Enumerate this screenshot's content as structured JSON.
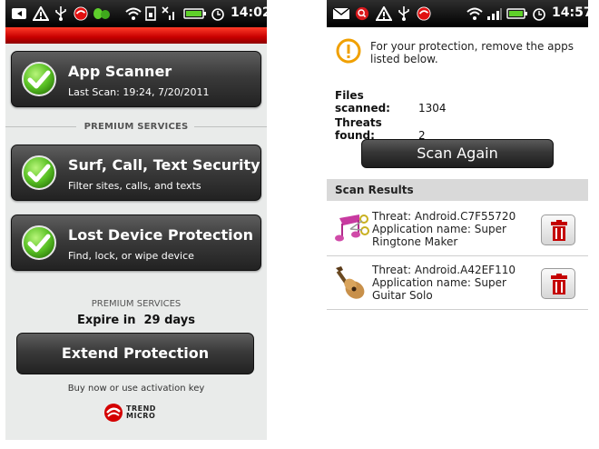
{
  "left": {
    "status": {
      "time": "14:02"
    },
    "features": [
      {
        "title": "App Scanner",
        "subtitle": "Last Scan: 19:24, 7/20/2011"
      },
      {
        "title": "Surf, Call, Text Security",
        "subtitle": "Filter sites, calls, and texts"
      },
      {
        "title": "Lost Device Protection",
        "subtitle": "Find, lock, or wipe device"
      }
    ],
    "premium_label": "PREMIUM SERVICES",
    "premium_label2": "PREMIUM SERVICES",
    "expire_text": "Expire in  29 days",
    "extend_button": "Extend Protection",
    "buy_now": "Buy now or use activation key",
    "logo_text": "TREND\nMICRO"
  },
  "right": {
    "status": {
      "time": "14:57"
    },
    "warning": "For your protection, remove the apps listed below.",
    "files_scanned": {
      "label": "Files scanned:",
      "value": "1304"
    },
    "threats_found": {
      "label": "Threats found:",
      "value": "2"
    },
    "scan_again": "Scan Again",
    "results_header": "Scan Results",
    "results": [
      {
        "threat": "Threat:  Android.C7F55720",
        "app": "Application name:  Super Ringtone Maker"
      },
      {
        "threat": "Threat:  Android.A42EF110",
        "app": "Application name:  Super Guitar Solo"
      }
    ]
  },
  "colors": {
    "accent_red": "#d40000",
    "button_dark": "#333333",
    "check_green": "#5cc22a",
    "warning_orange": "#f0a000"
  }
}
